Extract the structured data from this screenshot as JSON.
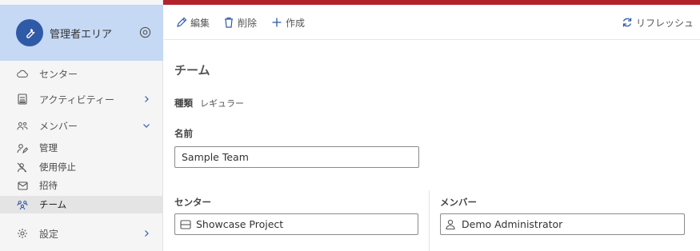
{
  "sidebar": {
    "header_title": "管理者エリア",
    "items": [
      {
        "label": "センター"
      },
      {
        "label": "アクティビティー"
      },
      {
        "label": "メンバー"
      },
      {
        "label": "管理"
      },
      {
        "label": "使用停止"
      },
      {
        "label": "招待"
      },
      {
        "label": "チーム"
      },
      {
        "label": "設定"
      }
    ]
  },
  "toolbar": {
    "edit_label": "編集",
    "delete_label": "削除",
    "create_label": "作成",
    "refresh_label": "リフレッシュ"
  },
  "main": {
    "title": "チーム",
    "kind_label": "種類",
    "kind_value": "レギュラー",
    "name_label": "名前",
    "name_value": "Sample Team",
    "center_label": "センター",
    "center_value": "Showcase Project",
    "member_label": "メンバー",
    "member_value": "Demo Administrator"
  },
  "colors": {
    "top_bar": "#b3222b",
    "sidebar_header": "#c5d8f4",
    "avatar": "#2f5aa8",
    "accent": "#2f5aa8"
  }
}
